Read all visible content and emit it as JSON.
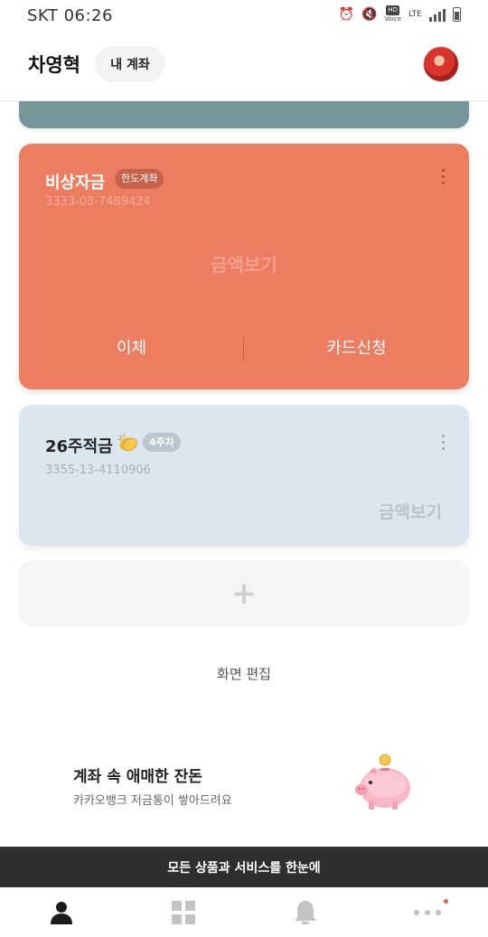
{
  "status_bar": {
    "carrier": "SKT",
    "time": "06:26",
    "hd_label": "HD",
    "volte_label": "Voice",
    "network": "LTE",
    "icons": [
      "alarm-icon",
      "mute-icon",
      "volte-icon",
      "lte-icon",
      "signal-icon",
      "battery-icon"
    ]
  },
  "header": {
    "user_name": "차영혁",
    "my_account_label": "내 계좌"
  },
  "accounts": [
    {
      "name": "비상자금",
      "badge": "한도계좌",
      "number": "3333-08-7489424",
      "balance_label": "금액보기",
      "actions": [
        "이체",
        "카드신청"
      ],
      "color": "#ec7d61"
    },
    {
      "name": "26주적금",
      "emoji": "clapping-hands-icon",
      "badge": "4주차",
      "number": "3355-13-4110906",
      "balance_label": "금액보기",
      "color": "#dae7ee"
    }
  ],
  "add_account_icon": "+",
  "edit_screen_label": "화면 편집",
  "promo": {
    "title": "계좌 속 애매한 잔돈",
    "subtitle": "카카오뱅크 저금통이 쌓아드려요"
  },
  "banner_text": "모든 상품과 서비스를 한눈에",
  "nav": [
    "person-icon",
    "grid-icon",
    "bell-icon",
    "more-icon"
  ],
  "colors": {
    "gray_card": "#76969a",
    "banner": "#2f2f2f",
    "notification_dot": "#f2574a"
  }
}
